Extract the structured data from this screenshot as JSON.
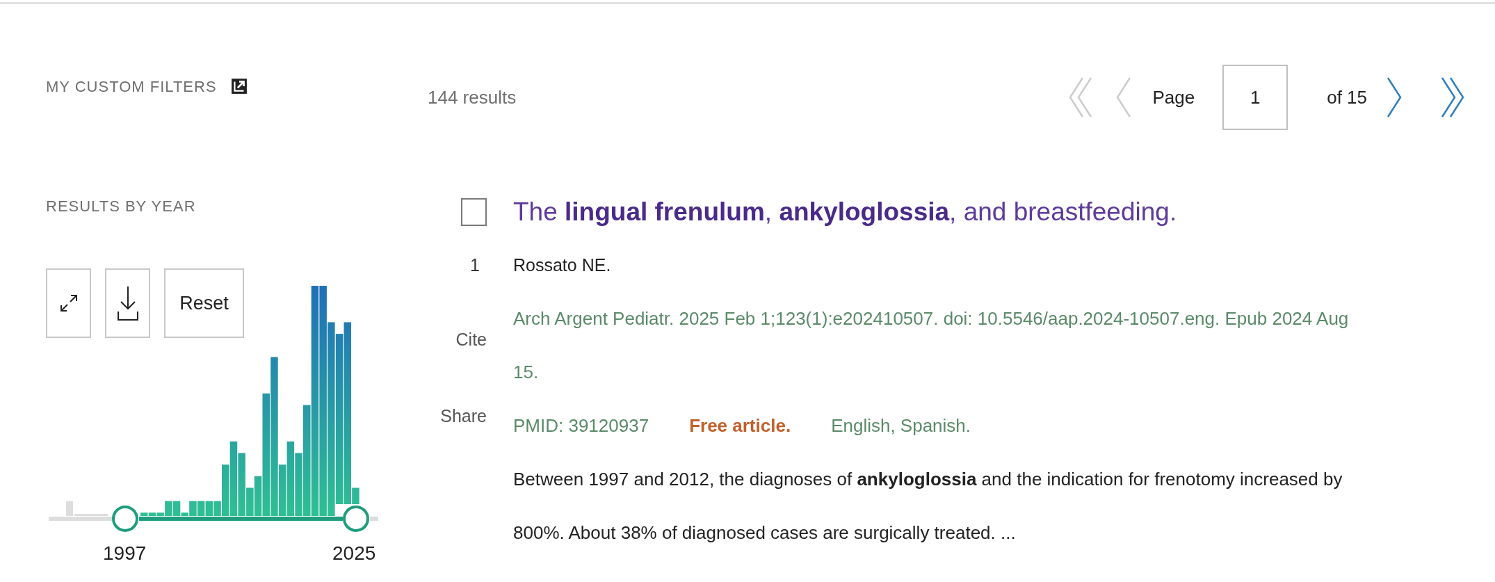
{
  "filters": {
    "title": "MY CUSTOM FILTERS"
  },
  "results_by_year": {
    "title": "RESULTS BY YEAR",
    "buttons": [
      {
        "kind": "expand"
      },
      {
        "kind": "download"
      },
      {
        "kind": "text",
        "label": "Reset"
      }
    ],
    "start_year": "1997",
    "end_year": "2025"
  },
  "results": {
    "count": "144 results"
  },
  "pager": {
    "first": {
      "disabled": true
    },
    "previous": {
      "disabled": true
    },
    "page_label": "Page",
    "page": "1",
    "of_label": "of 15",
    "next": {
      "disabled": false
    },
    "last": {
      "disabled": false
    }
  },
  "articles": [
    {
      "checked": false,
      "number": "1",
      "title": "The **lingual frenulum**, **ankyloglossia**, and breastfeeding.",
      "authors": "Rossato NE.",
      "citation": "Arch Argent Pediatr. 2025 Feb 1;123(1):e202410507. doi: 10.5546/aap.2024-10507.eng. Epub 2024 Aug 15.",
      "actions": [
        "Cite",
        "Share"
      ],
      "pmid": "PMID: 39120937",
      "free": "Free article.",
      "languages": "English, Spanish.",
      "snippet": "Between 1997 and 2012, the diagnoses of **ankyloglossia** and the indication for frenotomy increased by 800%. About 38% of diagnosed cases are surgically treated. ..."
    }
  ]
}
